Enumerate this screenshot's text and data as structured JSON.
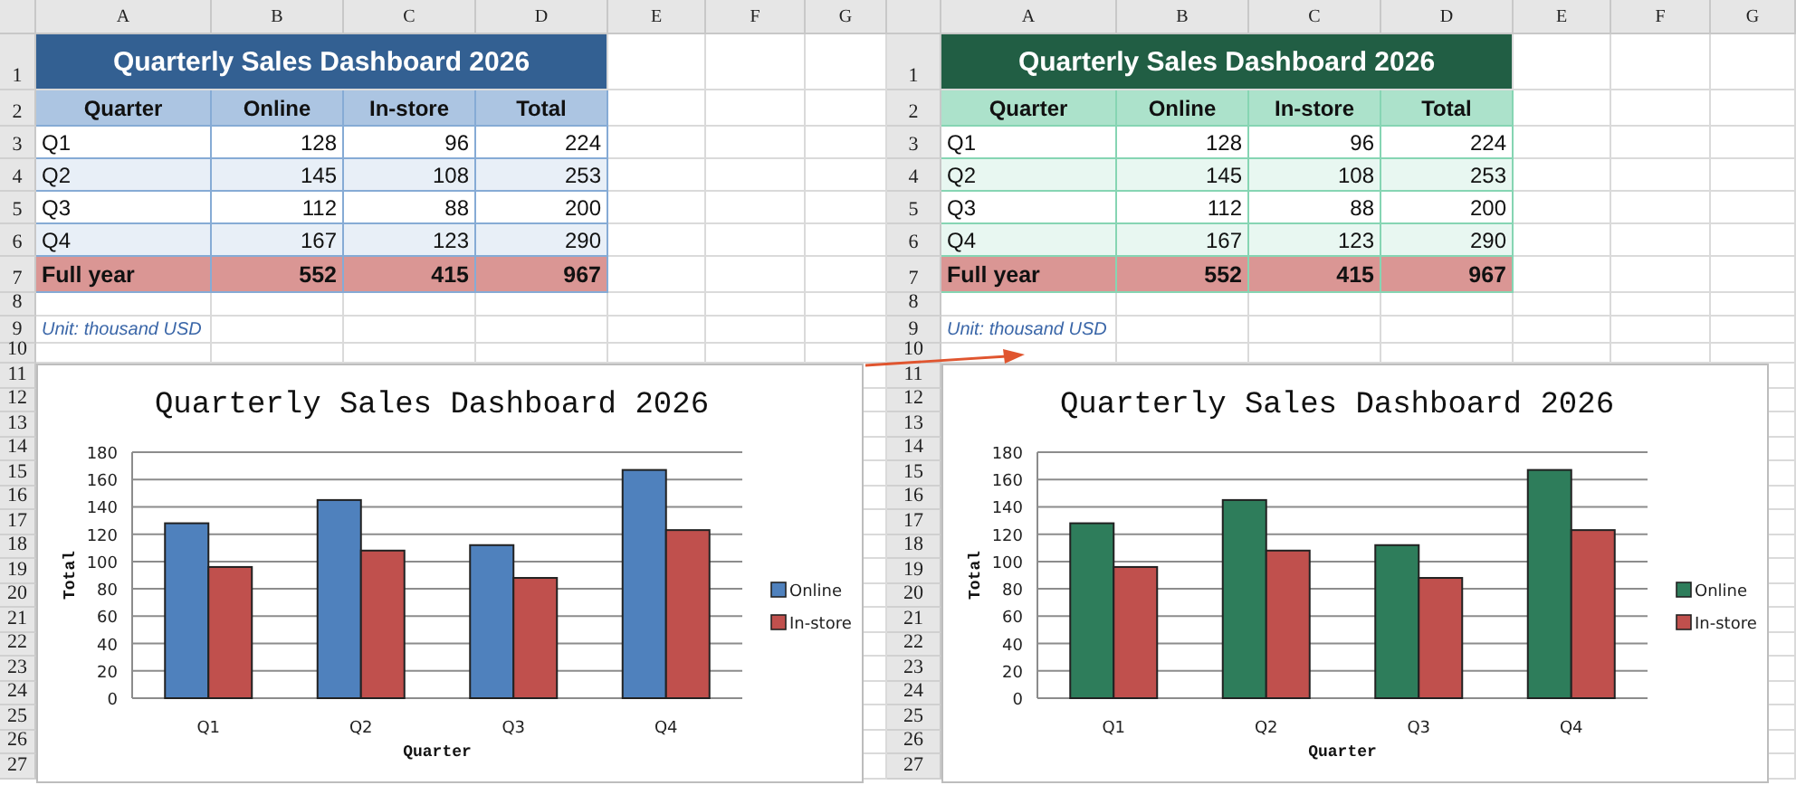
{
  "panels": [
    {
      "color": "#336092",
      "column_headers": [
        "A",
        "B",
        "C",
        "D",
        "E",
        "F",
        "G"
      ],
      "row_numbers": [
        "1",
        "2",
        "3",
        "4",
        "5",
        "6",
        "7",
        "8",
        "9",
        "10",
        "11",
        "12",
        "13",
        "14",
        "15",
        "16",
        "17",
        "18",
        "19",
        "20",
        "21",
        "22",
        "23",
        "24",
        "25",
        "26",
        "27"
      ],
      "table": {
        "title": "Quarterly Sales Dashboard 2026",
        "columns": [
          "Quarter",
          "Online",
          "In-store",
          "Total"
        ],
        "rows": [
          [
            "Q1",
            "128",
            "96",
            "224"
          ],
          [
            "Q2",
            "145",
            "108",
            "253"
          ],
          [
            "Q3",
            "112",
            "88",
            "200"
          ],
          [
            "Q4",
            "167",
            "123",
            "290"
          ]
        ],
        "total_row": [
          "Full year",
          "552",
          "415",
          "967"
        ],
        "note": "Unit: thousand USD"
      },
      "chart": {
        "chart_data": {
          "type": "bar",
          "title": "Quarterly Sales Dashboard 2026",
          "xlabel": "Quarter",
          "ylabel": "Total",
          "categories": [
            "Q1",
            "Q2",
            "Q3",
            "Q4"
          ],
          "series": [
            {
              "name": "Online",
              "color": "#4f81bd",
              "values": [
                128,
                145,
                112,
                167
              ]
            },
            {
              "name": "In-store",
              "color": "#c0504d",
              "values": [
                96,
                108,
                88,
                123
              ]
            }
          ],
          "ylim": [
            0,
            180
          ],
          "yticks": [
            0,
            20,
            40,
            60,
            80,
            100,
            120,
            140,
            160,
            180
          ],
          "grid": true,
          "legend": true
        }
      }
    },
    {
      "color": "#215e44",
      "column_headers": [
        "A",
        "B",
        "C",
        "D",
        "E",
        "F",
        "G"
      ],
      "row_numbers": [
        "1",
        "2",
        "3",
        "4",
        "5",
        "6",
        "7",
        "8",
        "9",
        "10",
        "11",
        "12",
        "13",
        "14",
        "15",
        "16",
        "17",
        "18",
        "19",
        "20",
        "21",
        "22",
        "23",
        "24",
        "25",
        "26",
        "27"
      ],
      "table": {
        "title": "Quarterly Sales Dashboard 2026",
        "columns": [
          "Quarter",
          "Online",
          "In-store",
          "Total"
        ],
        "rows": [
          [
            "Q1",
            "128",
            "96",
            "224"
          ],
          [
            "Q2",
            "145",
            "108",
            "253"
          ],
          [
            "Q3",
            "112",
            "88",
            "200"
          ],
          [
            "Q4",
            "167",
            "123",
            "290"
          ]
        ],
        "total_row": [
          "Full year",
          "552",
          "415",
          "967"
        ],
        "note": "Unit: thousand USD"
      },
      "chart": {
        "chart_data": {
          "type": "bar",
          "title": "Quarterly Sales Dashboard 2026",
          "xlabel": "Quarter",
          "ylabel": "Total",
          "categories": [
            "Q1",
            "Q2",
            "Q3",
            "Q4"
          ],
          "series": [
            {
              "name": "Online",
              "color": "#2e7d5b",
              "values": [
                128,
                145,
                112,
                167
              ]
            },
            {
              "name": "In-store",
              "color": "#c0504d",
              "values": [
                96,
                108,
                88,
                123
              ]
            }
          ],
          "ylim": [
            0,
            180
          ],
          "yticks": [
            0,
            20,
            40,
            60,
            80,
            100,
            120,
            140,
            160,
            180
          ],
          "grid": true,
          "legend": true
        }
      }
    }
  ]
}
